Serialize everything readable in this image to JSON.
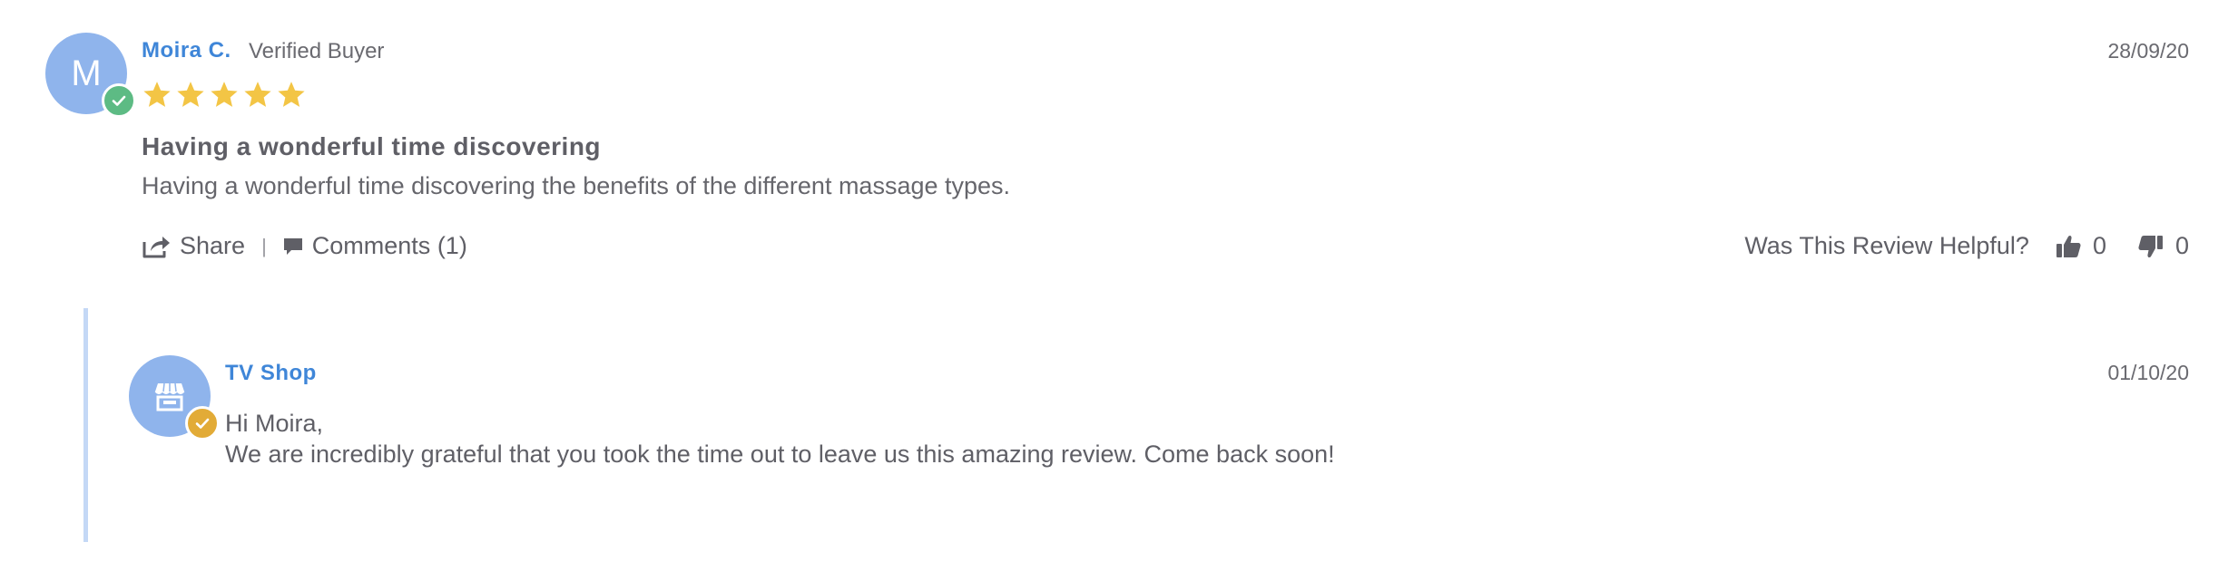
{
  "review": {
    "avatar_initial": "M",
    "author_name": "Moira C.",
    "verified_label": "Verified Buyer",
    "date": "28/09/20",
    "rating": 5,
    "rating_max": 5,
    "title": "Having a wonderful time discovering",
    "body": "Having a wonderful time discovering the benefits of the different massage types.",
    "actions": {
      "share_label": "Share",
      "separator": "|",
      "comments_label": "Comments (1)"
    },
    "helpful": {
      "question": "Was This Review Helpful?",
      "upvotes": "0",
      "downvotes": "0"
    }
  },
  "reply": {
    "author_name": "TV Shop",
    "date": "01/10/20",
    "greeting": "Hi Moira,",
    "body": "We are incredibly grateful that you took the time out to leave us this amazing review. Come back soon!"
  },
  "icons": {
    "verified_badge": "check-circle-icon",
    "store_badge": "check-circle-icon",
    "store_avatar": "store-icon",
    "share": "share-icon",
    "comments": "comment-icon",
    "thumbs_up": "thumbs-up-icon",
    "thumbs_down": "thumbs-down-icon",
    "star": "star-icon"
  },
  "colors": {
    "accent": "#3f86d8",
    "avatar_bg": "#8fb4ec",
    "star": "#f3c545",
    "verified_badge": "#5dbb84",
    "store_badge": "#e2ab37",
    "reply_bar": "#c4d8f6",
    "text": "#5f5f66"
  }
}
